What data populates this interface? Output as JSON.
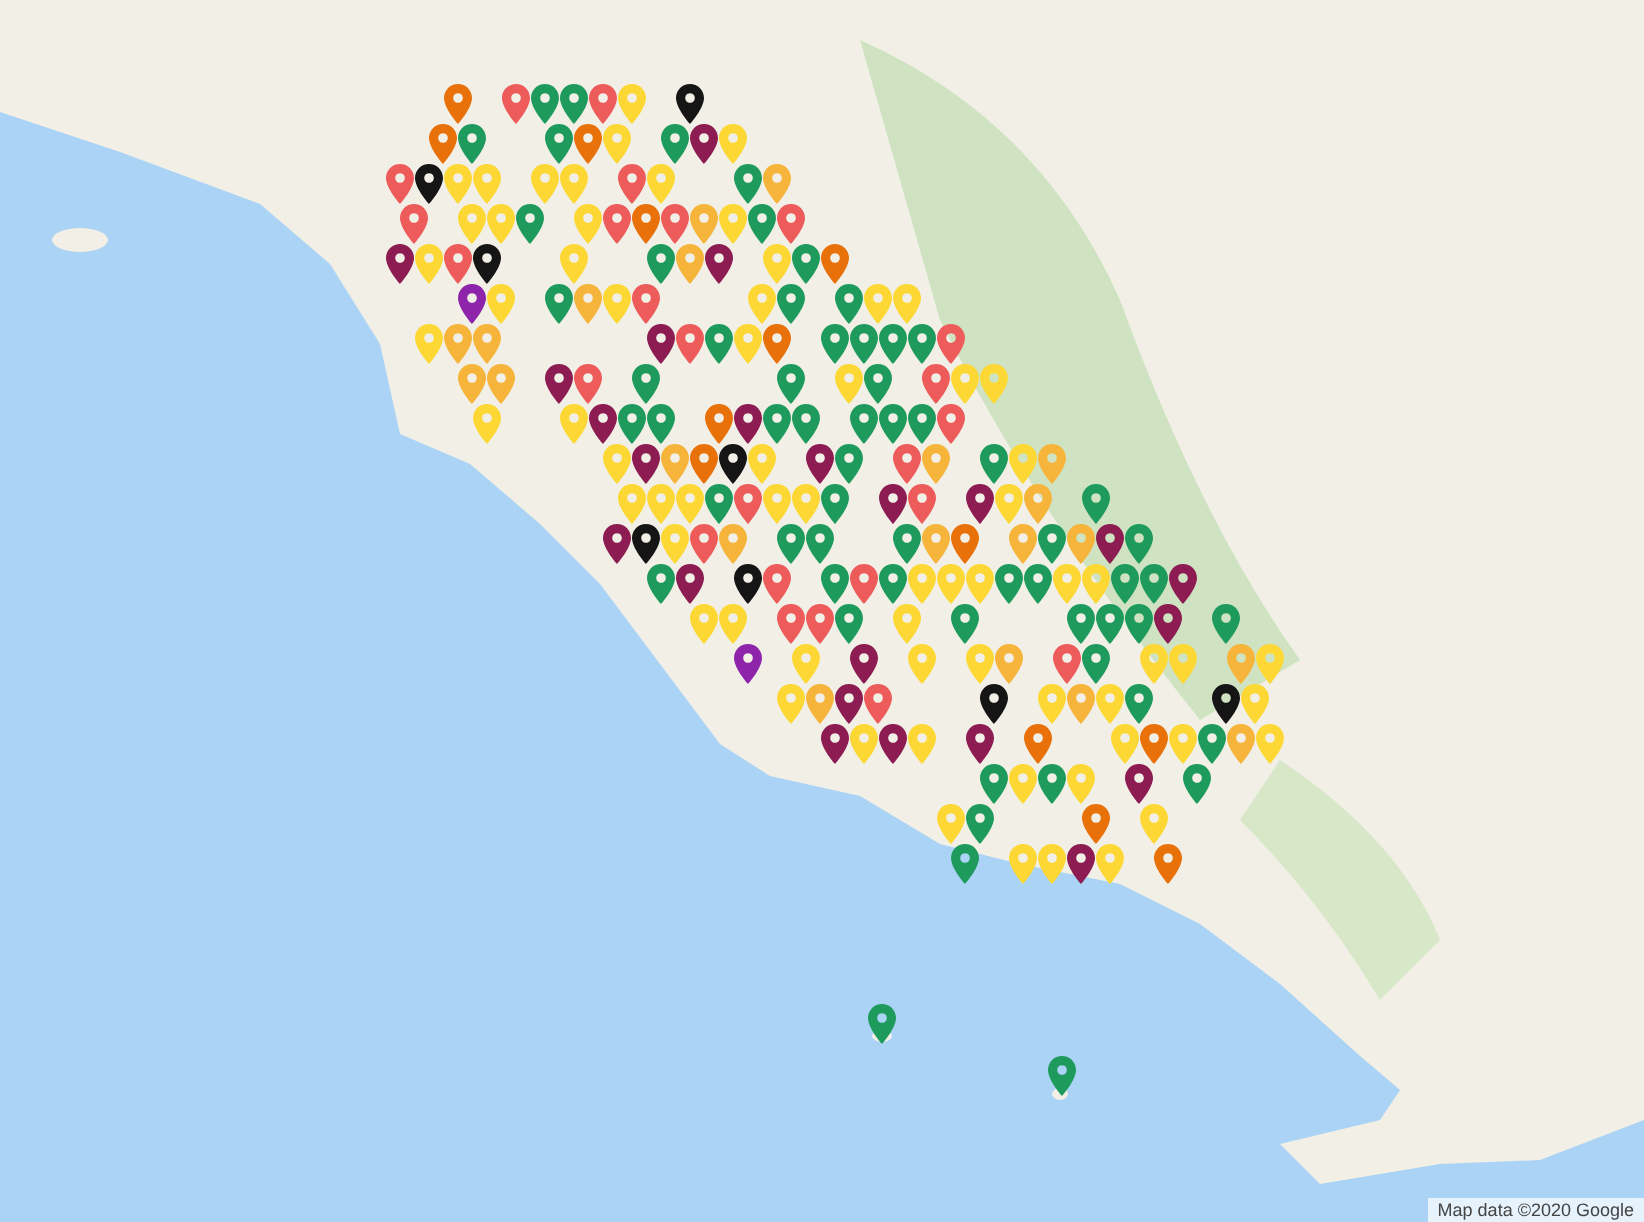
{
  "map": {
    "attribution": "Map data ©2020 Google",
    "pin_groups": [
      {
        "color": "#1e9b5c"
      },
      {
        "color": "#fdd835"
      },
      {
        "color": "#f6b53a"
      },
      {
        "color": "#e8710a"
      },
      {
        "color": "#ee5b5b"
      },
      {
        "color": "#8c1c52"
      },
      {
        "color": "#8e24aa"
      },
      {
        "color": "#151515"
      }
    ]
  }
}
